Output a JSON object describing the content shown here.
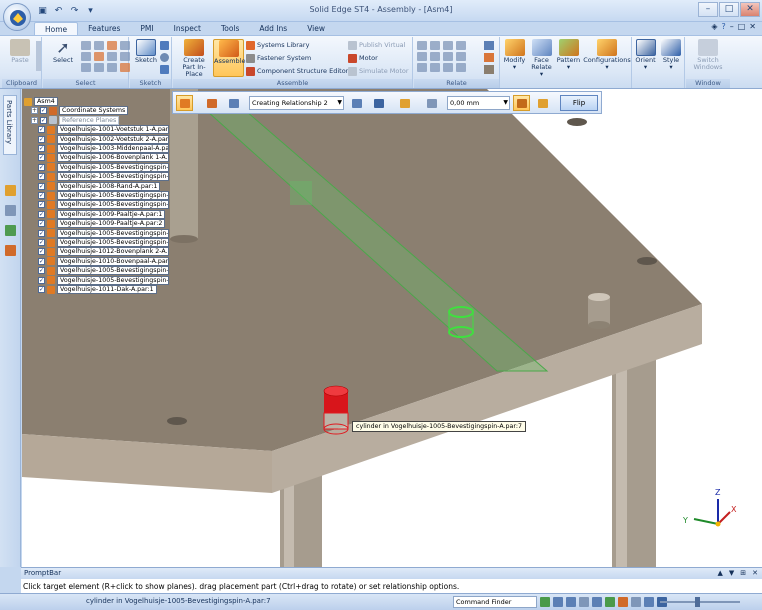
{
  "window": {
    "title": "Solid Edge ST4 - Assembly - [Asm4]",
    "controls": [
      "–",
      "□",
      "✕"
    ]
  },
  "tabs": [
    "Home",
    "Features",
    "PMI",
    "Inspect",
    "Tools",
    "Add Ins",
    "View"
  ],
  "active_tab": "Home",
  "ribbon": {
    "groups": {
      "clipboard": "Clipboard",
      "select": "Select",
      "sketch": "Sketch",
      "assemble": "Assemble",
      "relate": "Relate",
      "window": "Window"
    },
    "buttons": {
      "paste": "Paste",
      "select": "Select",
      "sketch": "Sketch",
      "create_part_in_place": "Create Part In-Place",
      "assemble": "Assemble",
      "modify": "Modify",
      "face_relate": "Face Relate",
      "pattern": "Pattern",
      "configurations": "Configurations",
      "orient": "Orient",
      "style": "Style",
      "switch_windows": "Switch Windows"
    },
    "assemble_items": {
      "systems_library": "Systems Library",
      "fastener_system": "Fastener System",
      "component_structure_editor": "Component Structure Editor",
      "publish_virtual": "Publish Virtual",
      "motor": "Motor",
      "simulate_motor": "Simulate Motor"
    }
  },
  "sidebar": {
    "parts_library": "Parts Library"
  },
  "command_bar": {
    "relationship_select": "Creating Relationship 2",
    "offset_value": "0,00 mm",
    "flip_label": "Flip"
  },
  "tree": {
    "root": "Asm4",
    "coordinate_systems": "Coordinate Systems",
    "reference_planes": "Reference Planes",
    "parts": [
      "Vogelhuisje-1001-Voetstuk 1-A.par:1",
      "Vogelhuisje-1002-Voetstuk 2-A.par:1",
      "Vogelhuisje-1003-Middenpaal-A.par:1",
      "Vogelhuisje-1006-Bovenplank 1-A.par:1",
      "Vogelhuisje-1005-Bevestigingspin-A.par:1",
      "Vogelhuisje-1005-Bevestigingspin-A.par:2",
      "Vogelhuisje-1008-Rand-A.par:1",
      "Vogelhuisje-1005-Bevestigingspin-A.par:3",
      "Vogelhuisje-1005-Bevestigingspin-A.par:4",
      "Vogelhuisje-1009-Paaltje-A.par:1",
      "Vogelhuisje-1009-Paaltje-A.par:2",
      "Vogelhuisje-1005-Bevestigingspin-A.par:5",
      "Vogelhuisje-1005-Bevestigingspin-A.par:6",
      "Vogelhuisje-1012-Bovenplank 2-A.par:1",
      "Vogelhuisje-1010-Bovenpaal-A.par:1",
      "Vogelhuisje-1005-Bevestigingspin-A.par:7",
      "Vogelhuisje-1005-Bevestigingspin-A.par:8",
      "Vogelhuisje-1011-Dak-A.par:1"
    ]
  },
  "viewport": {
    "tooltip": "cylinder in Vogelhuisje-1005-Bevestigingspin-A.par:7",
    "triad": {
      "x": "X",
      "y": "Y",
      "z": "Z"
    }
  },
  "prompt_bar": {
    "title": "PromptBar",
    "text": "Click target element (R+click to show planes). drag placement part (Ctrl+drag to rotate) or set relationship options."
  },
  "status_bar": {
    "status_text": "cylinder in Vogelhuisje-1005-Bevestigingspin-A.par:7",
    "command_finder": "Command Finder"
  },
  "colors": {
    "ribbon_bg": "#dbe7f6",
    "active_button": "#ffc65a",
    "plate_top": "#8a7e6f",
    "plate_side": "#b7ab9c",
    "highlight_green": "#5cd45c",
    "selected_part": "#d8151b"
  }
}
